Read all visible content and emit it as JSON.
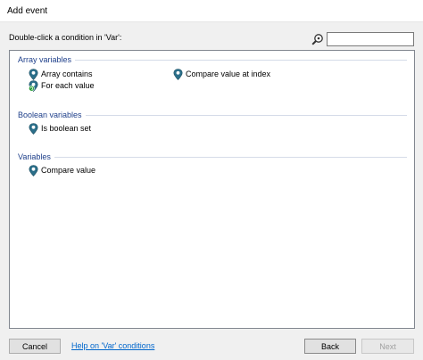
{
  "window": {
    "title": "Add event"
  },
  "instruction": "Double-click a condition in 'Var':",
  "search": {
    "value": "",
    "placeholder": ""
  },
  "categories": [
    {
      "name": "Array variables",
      "conditions": [
        {
          "label": "Array contains",
          "icon": "location-pin-icon"
        },
        {
          "label": "Compare value at index",
          "icon": "location-pin-icon"
        },
        {
          "label": "For each value",
          "icon": "loop-pin-icon"
        }
      ]
    },
    {
      "name": "Boolean variables",
      "conditions": [
        {
          "label": "Is boolean set",
          "icon": "location-pin-icon"
        }
      ]
    },
    {
      "name": "Variables",
      "conditions": [
        {
          "label": "Compare value",
          "icon": "location-pin-icon"
        }
      ]
    }
  ],
  "footer": {
    "cancel_label": "Cancel",
    "help_link_text": "Help on 'Var' conditions",
    "back_label": "Back",
    "next_label": "Next"
  },
  "colors": {
    "heading": "#1e3f8a",
    "pin": "#2b6f8a",
    "loop_badge": "#1f9b2e",
    "link": "#0066cc"
  }
}
